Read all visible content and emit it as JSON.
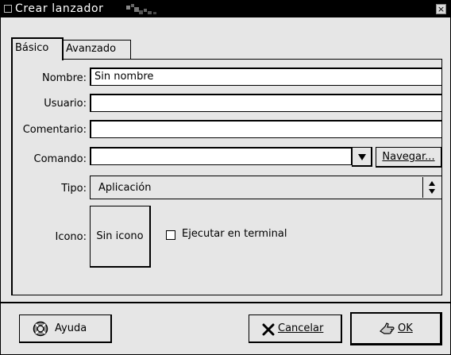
{
  "window": {
    "title": "Crear lanzador",
    "close_glyph": "×"
  },
  "tabs": [
    {
      "label": "Básico",
      "selected": true
    },
    {
      "label": "Avanzado",
      "selected": false
    }
  ],
  "form": {
    "name_label": "Nombre:",
    "name_value": "Sin nombre",
    "user_label": "Usuario:",
    "user_value": "",
    "comment_label": "Comentario:",
    "comment_value": "",
    "command_label": "Comando:",
    "command_value": "",
    "browse_label": "Navegar...",
    "type_label": "Tipo:",
    "type_value": "Aplicación",
    "icon_label": "Icono:",
    "icon_button_label": "Sin icono",
    "terminal_label": "Ejecutar en terminal",
    "terminal_checked": false
  },
  "buttons": {
    "help_label": "Ayuda",
    "cancel_label": "Cancelar",
    "ok_label": "OK"
  },
  "icons": {
    "help": "lifebuoy-icon",
    "cancel": "x-icon",
    "ok": "hand-ok-icon",
    "dropdown": "down-arrow-icon",
    "spinner": "up-down-arrows-icon"
  }
}
